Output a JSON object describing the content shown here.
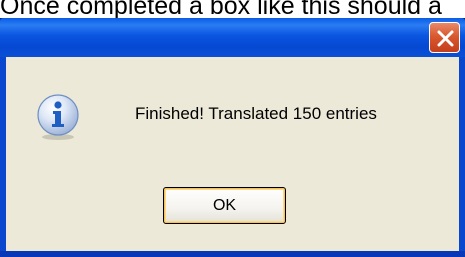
{
  "caption": {
    "text": "Once completed a box like this should a"
  },
  "dialog": {
    "message": "Finished! Translated 150 entries",
    "ok_label": "OK",
    "icon": "info-icon",
    "close_icon": "close-icon"
  },
  "colors": {
    "titlebar": "#0a55e0",
    "close_button": "#d9582f",
    "client_background": "#ece9d8",
    "info_icon_blue": "#1f5fc4"
  }
}
